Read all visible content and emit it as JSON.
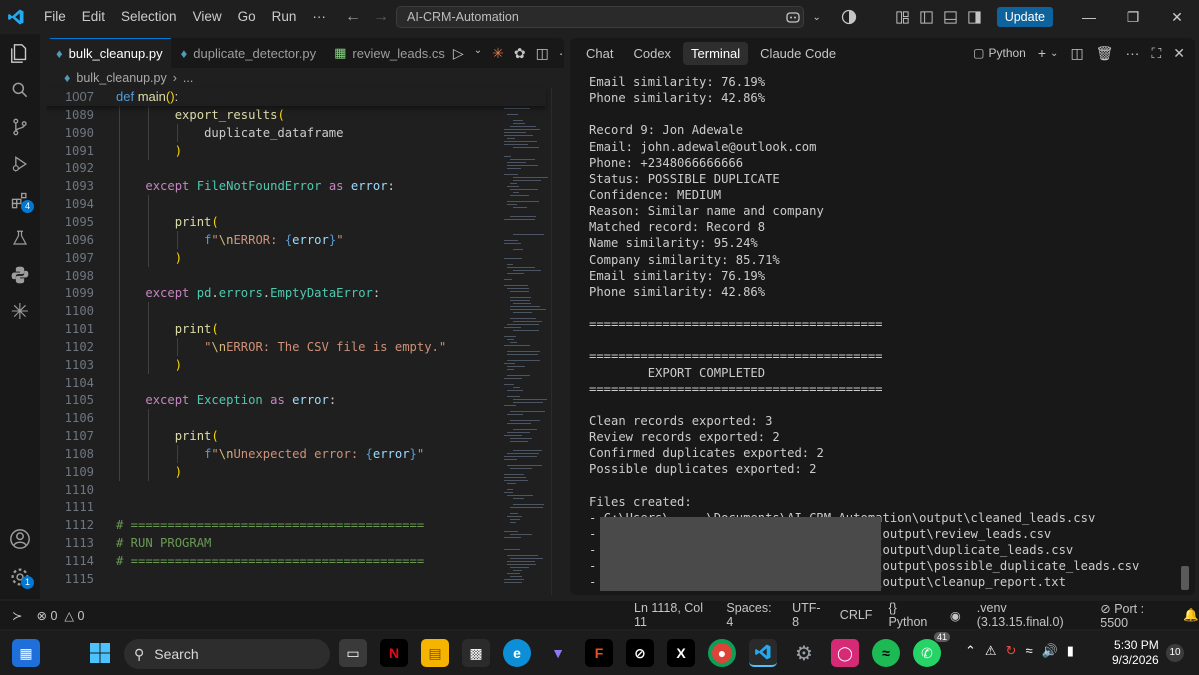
{
  "titlebar": {
    "menu": [
      "File",
      "Edit",
      "Selection",
      "View",
      "Go",
      "Run",
      "···"
    ],
    "search_text": "AI-CRM-Automation",
    "update_label": "Update",
    "icons": [
      "vscode-logo-icon",
      "back-icon",
      "forward-icon",
      "copilot-icon",
      "chevron-down-icon",
      "accounts-icon",
      "layout-icon",
      "toggle-sidebar-icon",
      "toggle-panel-icon",
      "toggle-secondary-sidebar-icon",
      "minimize-icon",
      "restore-icon",
      "close-icon"
    ]
  },
  "activitybar": {
    "items": [
      "explorer",
      "search",
      "source-control",
      "run-debug",
      "extensions",
      "testing",
      "python",
      "claude"
    ],
    "extensions_badge": "4",
    "settings_badge": "1"
  },
  "editor": {
    "tabs": [
      {
        "label": "bulk_cleanup.py",
        "active": true
      },
      {
        "label": "duplicate_detector.py",
        "active": false
      },
      {
        "label": "review_leads.cs",
        "active": false
      }
    ],
    "breadcrumb": [
      "bulk_cleanup.py",
      "..."
    ],
    "sticky": {
      "num": "1007",
      "text": "def main():"
    },
    "lines": [
      {
        "num": "1089",
        "text": "export_results("
      },
      {
        "num": "1090",
        "text": "duplicate_dataframe"
      },
      {
        "num": "1091",
        "text": ")"
      },
      {
        "num": "1092",
        "text": ""
      },
      {
        "num": "1093",
        "text": "except FileNotFoundError as error:"
      },
      {
        "num": "1094",
        "text": ""
      },
      {
        "num": "1095",
        "text": "print("
      },
      {
        "num": "1096",
        "text": "f\"\\nERROR: {error}\""
      },
      {
        "num": "1097",
        "text": ")"
      },
      {
        "num": "1098",
        "text": ""
      },
      {
        "num": "1099",
        "text": "except pd.errors.EmptyDataError:"
      },
      {
        "num": "1100",
        "text": ""
      },
      {
        "num": "1101",
        "text": "print("
      },
      {
        "num": "1102",
        "text": "\"\\nERROR: The CSV file is empty.\""
      },
      {
        "num": "1103",
        "text": ")"
      },
      {
        "num": "1104",
        "text": ""
      },
      {
        "num": "1105",
        "text": "except Exception as error:"
      },
      {
        "num": "1106",
        "text": ""
      },
      {
        "num": "1107",
        "text": "print("
      },
      {
        "num": "1108",
        "text": "f\"\\nUnexpected error: {error}\""
      },
      {
        "num": "1109",
        "text": ")"
      },
      {
        "num": "1110",
        "text": ""
      },
      {
        "num": "1111",
        "text": ""
      },
      {
        "num": "1112",
        "text": "# ========================================"
      },
      {
        "num": "1113",
        "text": "# RUN PROGRAM"
      },
      {
        "num": "1114",
        "text": "# ========================================"
      },
      {
        "num": "1115",
        "text": ""
      }
    ]
  },
  "panel": {
    "tabs": [
      "Chat",
      "Codex",
      "Terminal",
      "Claude Code"
    ],
    "active_tab": "Terminal",
    "shell_label": "Python",
    "terminal_lines": [
      "Email similarity: 76.19%",
      "Phone similarity: 42.86%",
      "",
      "Record 9: Jon Adewale",
      "Email: john.adewale@outlook.com",
      "Phone: +2348066666666",
      "Status: POSSIBLE DUPLICATE",
      "Confidence: MEDIUM",
      "Reason: Similar name and company",
      "Matched record: Record 8",
      "Name similarity: 95.24%",
      "Company similarity: 85.71%",
      "Email similarity: 76.19%",
      "Phone similarity: 42.86%",
      "",
      "========================================",
      "",
      "========================================",
      "        EXPORT COMPLETED",
      "========================================",
      "",
      "Clean records exported: 3",
      "Review records exported: 2",
      "Confirmed duplicates exported: 2",
      "Possible duplicates exported: 2",
      "",
      "Files created:",
      "- C:\\Users\\     \\Documents\\AI-CRM-Automation\\output\\cleaned_leads.csv",
      "-                                 ation\\output\\review_leads.csv",
      "-                                 ation\\output\\duplicate_leads.csv",
      "-                                 ation\\output\\possible_duplicate_leads.csv",
      "-                                 ation\\output\\cleanup_report.txt"
    ]
  },
  "statusbar": {
    "problems": "0",
    "warnings": "0",
    "position": "Ln 1118, Col 11",
    "spaces": "Spaces: 4",
    "encoding": "UTF-8",
    "eol": "CRLF",
    "language": "Python",
    "venv": ".venv (3.13.15.final.0)",
    "port": "Port : 5500"
  },
  "taskbar": {
    "search_label": "Search",
    "time": "5:30 PM",
    "date": "9/3/2026",
    "whatsapp_badge": "41",
    "notif_count": "10",
    "apps": [
      "windows-start",
      "task-view",
      "netflix",
      "file-explorer",
      "store",
      "edge",
      "proton-vpn",
      "figma",
      "terminal",
      "x",
      "chrome",
      "vscode",
      "settings",
      "instagram",
      "spotify",
      "whatsapp"
    ]
  }
}
